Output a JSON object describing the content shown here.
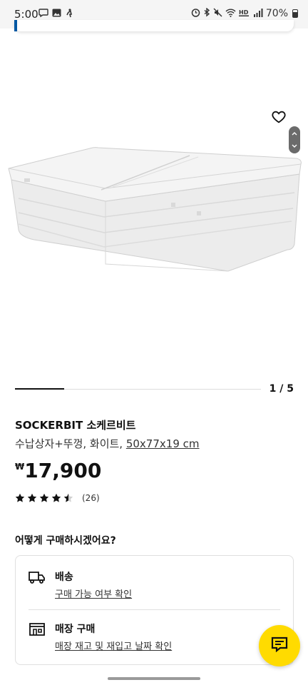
{
  "status_bar": {
    "time": "5:00",
    "left_icons": [
      "chat-bubble-icon",
      "image-icon",
      "accessibility-icon"
    ],
    "right_icons": [
      "alarm-icon",
      "bluetooth-icon",
      "mute-icon",
      "wifi-icon",
      "hd-voice-icon",
      "signal-icon"
    ],
    "battery": "70%"
  },
  "gallery": {
    "pager": "1 / 5",
    "current_image": 1,
    "total_images": 5
  },
  "product": {
    "name": "SOCKERBIT 소케르비트",
    "description": "수납상자+뚜껑, 화이트, ",
    "dimensions": "50x77x19 cm",
    "currency_symbol": "₩",
    "price": "17,900",
    "rating": 4.5,
    "reviews": "(26)"
  },
  "purchase": {
    "heading": "어떻게 구매하시겠어요?",
    "delivery_title": "배송",
    "delivery_link": "구매 가능 여부 확인",
    "store_title": "매장 구매",
    "store_link": "매장 재고 및 재입고 날짜 확인"
  },
  "colors": {
    "accent": "#0058a3",
    "fab": "#ffdb00",
    "text": "#111111"
  }
}
